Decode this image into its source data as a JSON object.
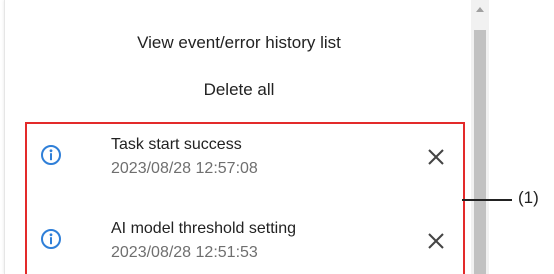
{
  "menu": {
    "view_history_label": "View event/error history list",
    "delete_all_label": "Delete all"
  },
  "events": [
    {
      "icon": "info-icon",
      "title": "Task start success",
      "timestamp": "2023/08/28 12:57:08"
    },
    {
      "icon": "info-icon",
      "title": "AI model threshold setting",
      "timestamp": "2023/08/28 12:51:53"
    }
  ],
  "annotation": {
    "label": "(1)"
  },
  "colors": {
    "info_icon": "#2f7fd8",
    "highlight_border": "#e32a2a",
    "scroll_thumb": "#c1c1c1"
  }
}
